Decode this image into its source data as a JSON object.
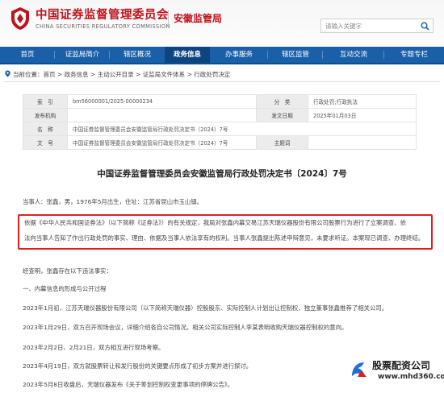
{
  "header": {
    "org_name_cn": "中国证券监督管理委员会",
    "org_name_en": "CHINA SECURITIES REGULATORY COMMISSION",
    "sub_bureau": "安徽监管局",
    "search": {
      "placeholder": "请输入关键字"
    }
  },
  "colors": {
    "brand_red": "#c1121c",
    "nav_blue": "#1960a8",
    "nav_active": "#0d4580",
    "highlight_red": "#e02020"
  },
  "nav": {
    "items": [
      {
        "label": "首页"
      },
      {
        "label": "证监局简介"
      },
      {
        "label": "辖区概况"
      },
      {
        "label": "政务信息",
        "active": true
      },
      {
        "label": "办事服务"
      },
      {
        "label": "辖区监管"
      },
      {
        "label": "互动交流"
      },
      {
        "label": "专题专栏"
      }
    ]
  },
  "breadcrumb": {
    "prefix": "当前位置：",
    "items": [
      "首页",
      "政务信息",
      "主动公开目录",
      "证监局文件体系",
      "行政处罚决定"
    ],
    "separator": " > "
  },
  "meta": {
    "index_label": "索　引",
    "index_value": "bm56000001/2025-00000234",
    "category_label": "分　类",
    "category_value": "行政处罚;行政执法",
    "issuer_label": "发布机构",
    "issuer_value": "",
    "date_label": "发文日期",
    "date_value": "2025年01月03日",
    "name_label": "名　称",
    "name_value": "中国证券监督管理委员会安徽监管局行政处罚决定书（2024）7号",
    "docno_label": "文　号",
    "docno_value": "中国证券监督管理委员会安徽监管局行政处罚决定书（2024）7号",
    "topic_label": "主题词",
    "topic_value": ""
  },
  "document": {
    "title": "中国证券监督管理委员会安徽监管局行政处罚决定书〔2024〕7号",
    "party": "当事人：张鑫，男，1976年5月出生，住址：江苏省昆山市玉山镇。",
    "highlight_lines": [
      "依据《中华人民共和国证券法》（以下简称《证券法》）的有关规定，我局对张鑫内幕交易江苏天瑞仪器股份有限公司股票行为进行了立案调查、依",
      "法向当事人告知了作出行政处罚的事实、理由、依据及当事人依法享有的权利。当事人张鑫提出陈述申辩意见，未要求听证。本案现已调查、办理终结。"
    ],
    "findings_intro": "经查明，张鑫存在以下违法事实：",
    "section_heading": "一、内幕信息的形成与公开过程",
    "paragraphs": [
      "2023年1月初，江苏天瑞仪器股份有限公司（以下简称天瑞仪器）控股股东、实际控制人计划出让控制权，独立董事张鑫推荐了相关公司。",
      "2023年1月29日，双方召开现场会议，详细介绍各自公司情况。相关公司实际控制人李某表明收购天瑞仪器控制权的意向。",
      "2023年2月2日、2月21日，双方相互进行现场考察。",
      "2023年4月19日，双方就股票转让和发行股份的关键要点形成了初步方案并进行探讨。",
      "2023年5月8日收盘后，天瑞仪器发布《关于筹划控制权变更事项的停牌公告》。"
    ]
  },
  "watermark": {
    "name": "股票配资公司",
    "url": "www.mhd360.com"
  }
}
